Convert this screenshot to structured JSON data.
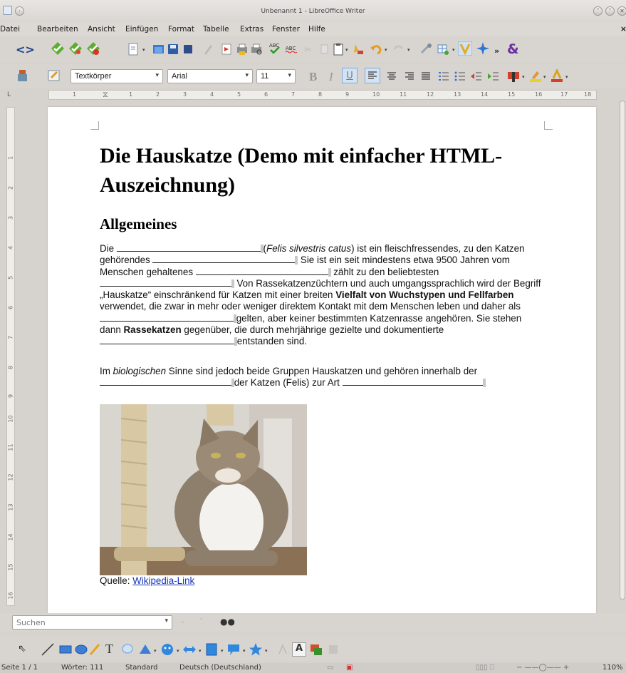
{
  "window": {
    "title": "Unbenannt 1 - LibreOffice Writer"
  },
  "menu": [
    "Datei",
    "Bearbeiten",
    "Ansicht",
    "Einfügen",
    "Format",
    "Tabelle",
    "Extras",
    "Fenster",
    "Hilfe"
  ],
  "format_toolbar": {
    "paragraph_style": "Textkörper",
    "font_name": "Arial",
    "font_size": "11"
  },
  "ruler": {
    "h_ticks": [
      "1",
      "1",
      "2",
      "3",
      "4",
      "5",
      "6",
      "7",
      "8",
      "9",
      "10",
      "11",
      "12",
      "13",
      "14",
      "15",
      "16",
      "17",
      "18"
    ],
    "v_ticks": [
      "1",
      "2",
      "3",
      "4",
      "5",
      "6",
      "7",
      "8",
      "9",
      "10",
      "11",
      "12",
      "13",
      "14",
      "15",
      "16"
    ]
  },
  "document": {
    "heading1": "Die Hauskatze (Demo mit einfacher HTML-Auszeichnung)",
    "heading2": "Allgemeines",
    "para1": {
      "t1": "Die ",
      "t2": " (",
      "i1": "Felis silvestris catus",
      "t3": ") ist ein fleischfressendes, zu den Katzen gehörendes ",
      "t4": ". Sie ist ein seit mindestens etwa 9500 Jahren vom Menschen gehaltenes ",
      "t5": ". zählt zu den beliebtesten ",
      "t6": ". Von Rassekatzenzüchtern und auch umgangssprachlich wird der Begriff „Hauskatze“ einschränkend für Katzen mit einer breiten ",
      "b1": "Vielfalt von Wuchstypen und Fellfarben",
      "t7": " verwendet, die zwar in mehr oder weniger direktem Kontakt mit dem Menschen leben und daher als ",
      "t8": " gelten, aber keiner bestimmten Katzenrasse angehören. Sie stehen dann ",
      "b2": "Rassekatzen",
      "t9": " gegenüber, die durch mehrjährige gezielte und dokumentierte",
      "t10": " entstanden sind."
    },
    "para2": {
      "t1": "Im ",
      "i1": "biologischen",
      "t2": " Sinne sind jedoch beide Gruppen Hauskatzen und gehören innerhalb der ",
      "t3": " der Katzen (Felis) zur Art ",
      "t4": "."
    },
    "caption": {
      "prefix": "Quelle: ",
      "link": "Wikipedia-Link"
    }
  },
  "find": {
    "placeholder": "Suchen"
  },
  "status": {
    "page": "Seite 1 / 1",
    "words": "Wörter: 111",
    "style": "Standard",
    "language": "Deutsch (Deutschland)",
    "zoom": "110%"
  }
}
